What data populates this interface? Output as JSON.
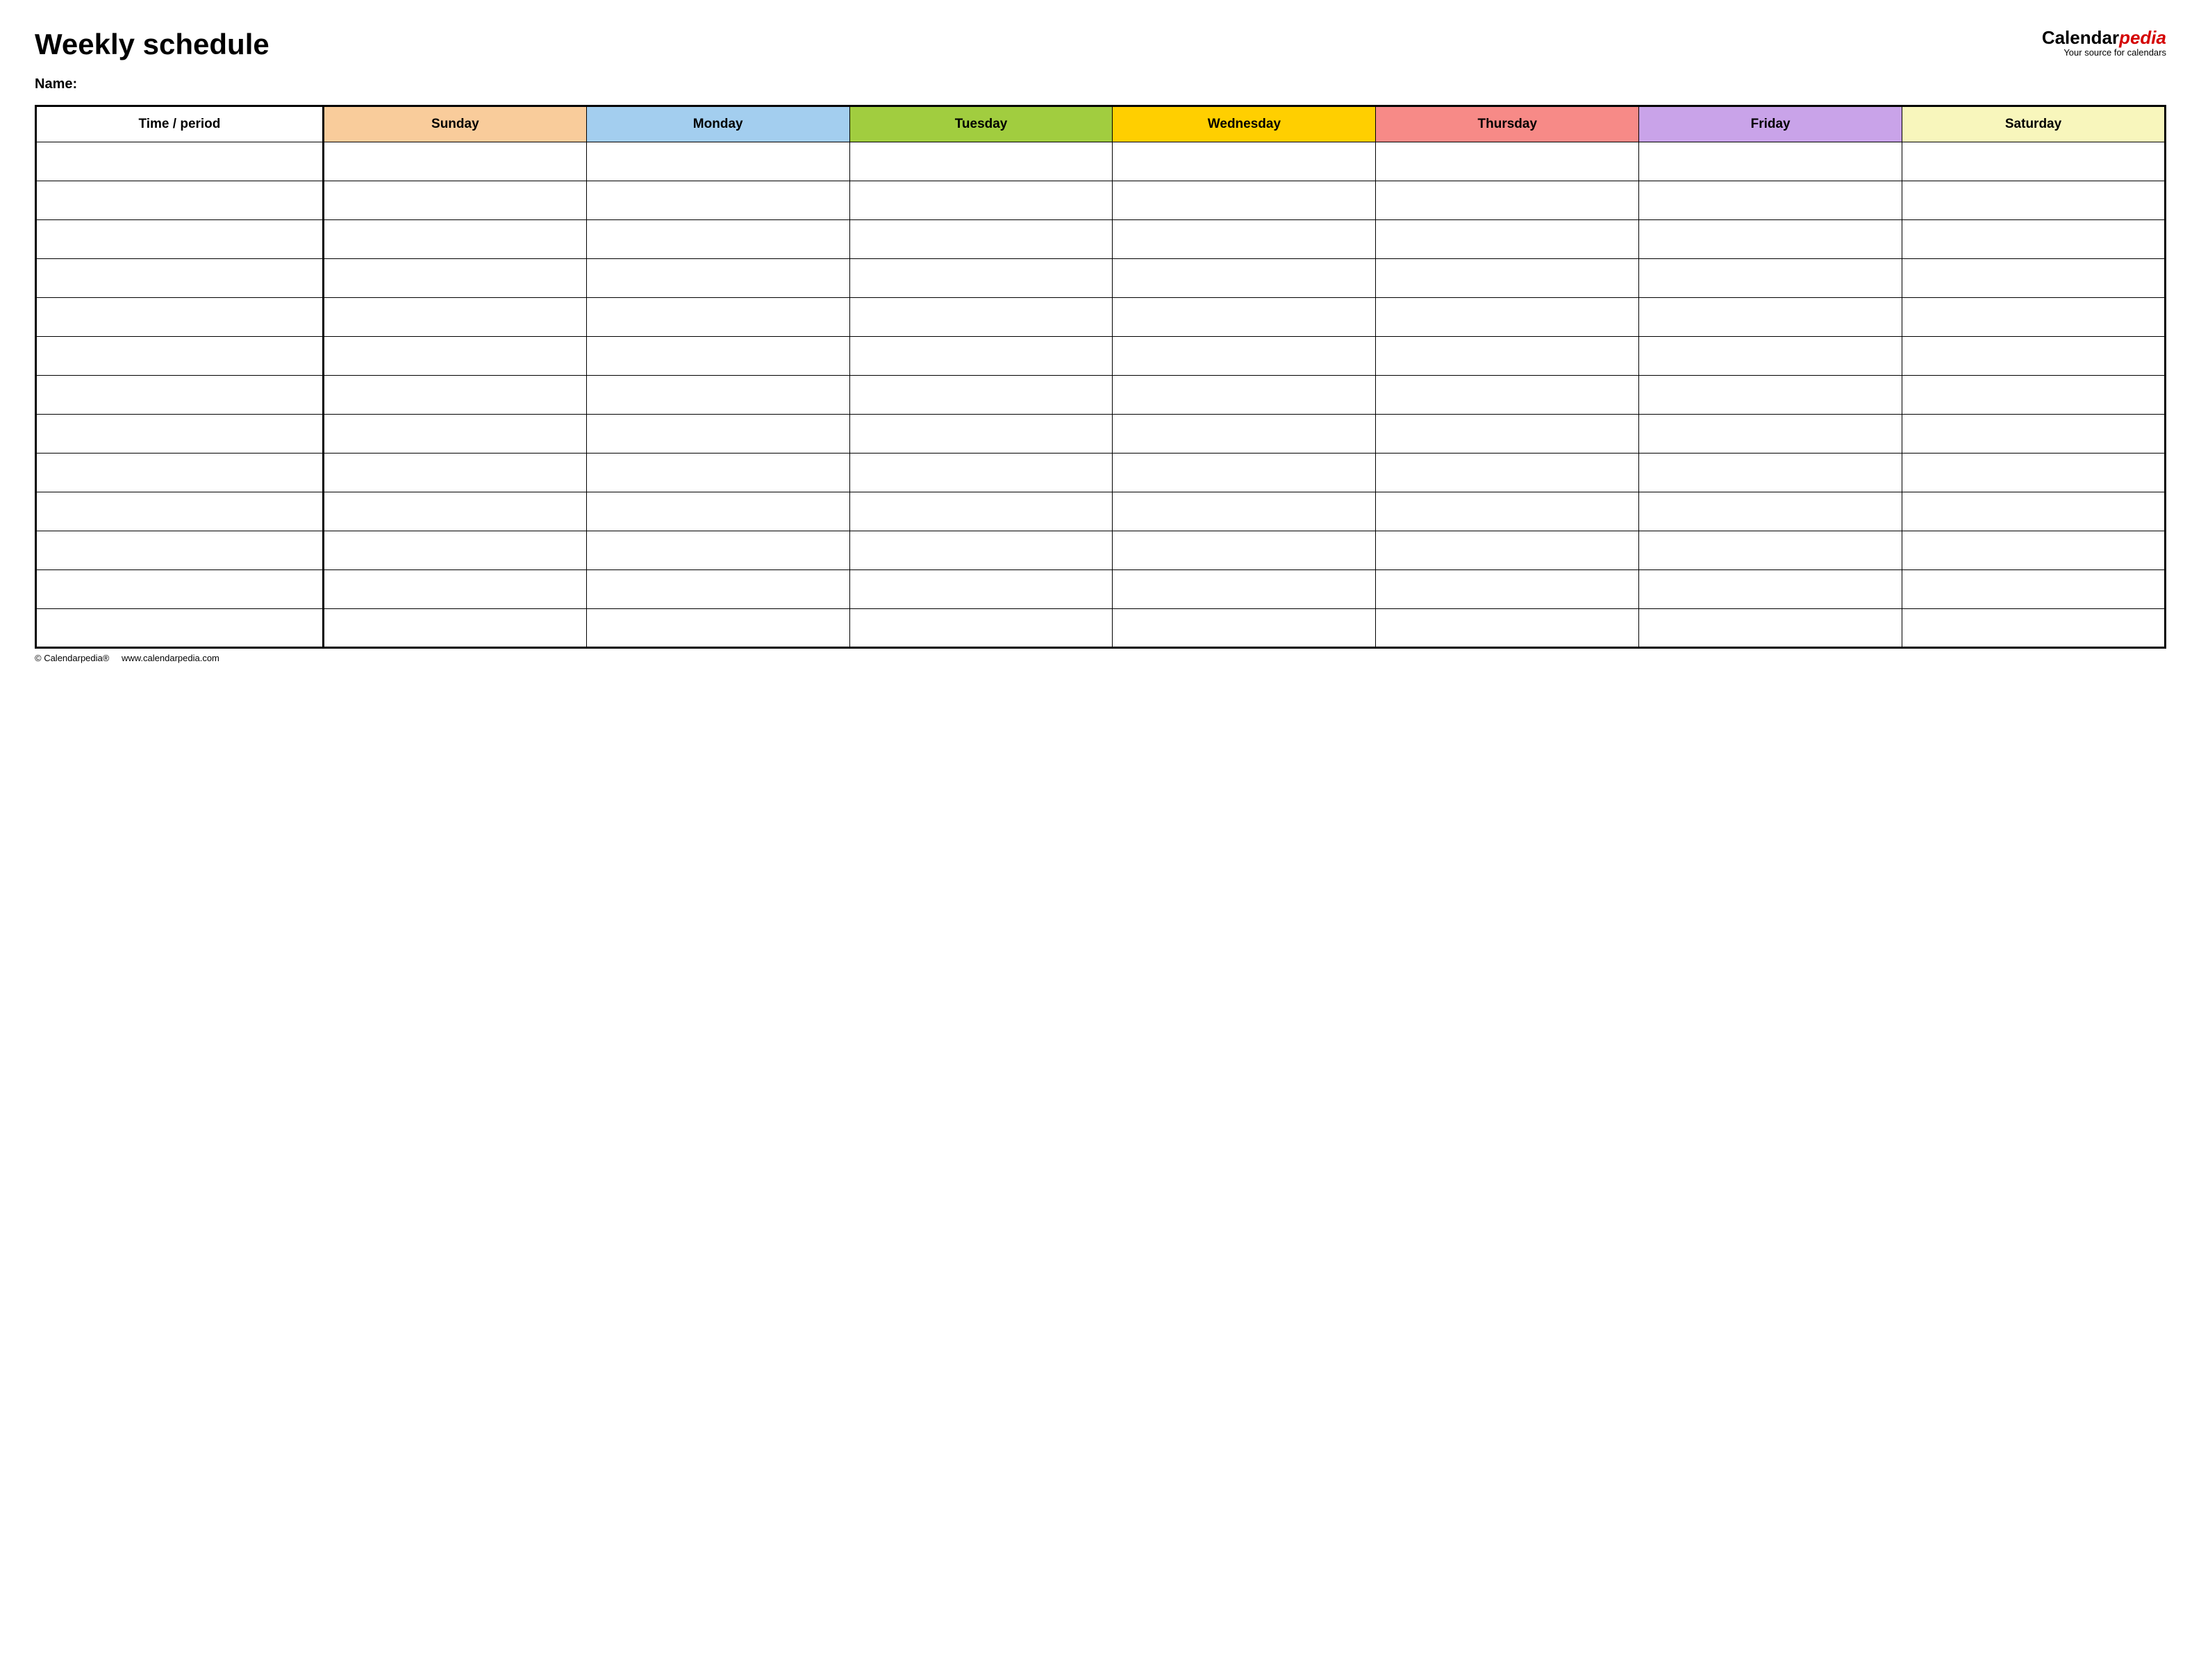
{
  "header": {
    "title": "Weekly schedule",
    "brand_prefix": "Calendar",
    "brand_accent": "pedia",
    "brand_tag": "Your source for calendars",
    "name_label": "Name:"
  },
  "table": {
    "time_header": "Time / period",
    "days": [
      {
        "label": "Sunday",
        "color": "#f9cc9b"
      },
      {
        "label": "Monday",
        "color": "#a3ceef"
      },
      {
        "label": "Tuesday",
        "color": "#a1cd3f"
      },
      {
        "label": "Wednesday",
        "color": "#ffcf00"
      },
      {
        "label": "Thursday",
        "color": "#f78a87"
      },
      {
        "label": "Friday",
        "color": "#c9a3e9"
      },
      {
        "label": "Saturday",
        "color": "#f8f6bc"
      }
    ],
    "row_count": 13
  },
  "footer": {
    "copyright": "© Calendarpedia®",
    "url": "www.calendarpedia.com"
  }
}
